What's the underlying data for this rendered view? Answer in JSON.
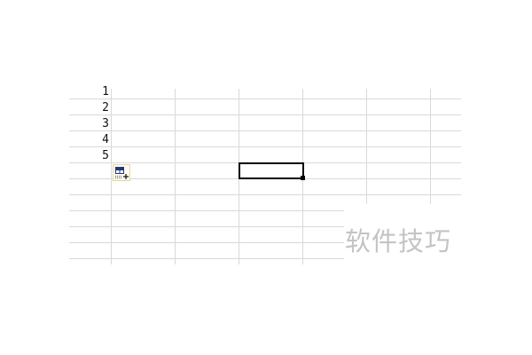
{
  "sheet": {
    "row_values": [
      "1",
      "2",
      "3",
      "4",
      "5"
    ],
    "autofill_options_icon": "autofill-options-icon"
  },
  "watermark": {
    "text": "软件技巧"
  }
}
